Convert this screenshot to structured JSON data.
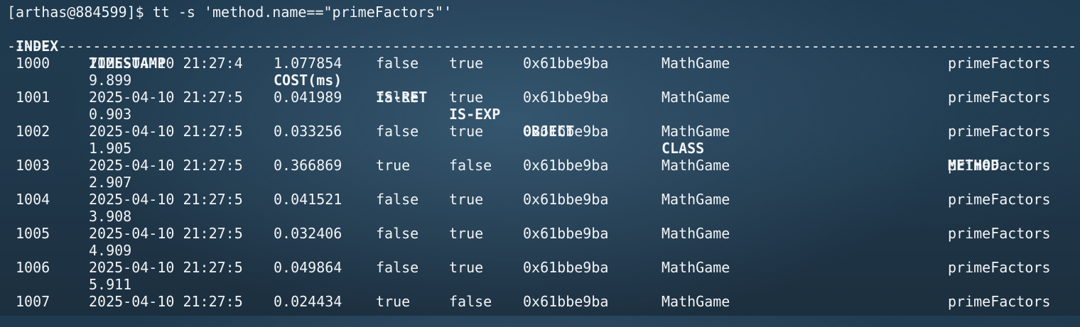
{
  "terminal": {
    "prompt": "[arthas@884599]$ tt -s 'method.name==\"primeFactors\"'",
    "headers": {
      "index": "INDEX",
      "timestamp": "TIMESTAMP",
      "cost": "COST(ms)",
      "is_ret": "IS-RET",
      "is_exp": "IS-EXP",
      "object": "OBJECT",
      "class": "CLASS",
      "method": "METHOD"
    },
    "separator": "--------------------------------------------------------------------------------------------------------------------------------------------------------------------------------------",
    "rows": [
      {
        "index": "1000",
        "ts1": "2025-04-10 21:27:4",
        "ts2": "9.899",
        "cost": "1.077854",
        "is_ret": "false",
        "is_exp": "true",
        "object": "0x61bbe9ba",
        "class": "MathGame",
        "method": "primeFactors"
      },
      {
        "index": "1001",
        "ts1": "2025-04-10 21:27:5",
        "ts2": "0.903",
        "cost": "0.041989",
        "is_ret": "false",
        "is_exp": "true",
        "object": "0x61bbe9ba",
        "class": "MathGame",
        "method": "primeFactors"
      },
      {
        "index": "1002",
        "ts1": "2025-04-10 21:27:5",
        "ts2": "1.905",
        "cost": "0.033256",
        "is_ret": "false",
        "is_exp": "true",
        "object": "0x61bbe9ba",
        "class": "MathGame",
        "method": "primeFactors"
      },
      {
        "index": "1003",
        "ts1": "2025-04-10 21:27:5",
        "ts2": "2.907",
        "cost": "0.366869",
        "is_ret": "true",
        "is_exp": "false",
        "object": "0x61bbe9ba",
        "class": "MathGame",
        "method": "primeFactors"
      },
      {
        "index": "1004",
        "ts1": "2025-04-10 21:27:5",
        "ts2": "3.908",
        "cost": "0.041521",
        "is_ret": "false",
        "is_exp": "true",
        "object": "0x61bbe9ba",
        "class": "MathGame",
        "method": "primeFactors"
      },
      {
        "index": "1005",
        "ts1": "2025-04-10 21:27:5",
        "ts2": "4.909",
        "cost": "0.032406",
        "is_ret": "false",
        "is_exp": "true",
        "object": "0x61bbe9ba",
        "class": "MathGame",
        "method": "primeFactors"
      },
      {
        "index": "1006",
        "ts1": "2025-04-10 21:27:5",
        "ts2": "5.911",
        "cost": "0.049864",
        "is_ret": "false",
        "is_exp": "true",
        "object": "0x61bbe9ba",
        "class": "MathGame",
        "method": "primeFactors"
      },
      {
        "index": "1007",
        "ts1": "2025-04-10 21:27:5",
        "ts2": "",
        "cost": "0.024434",
        "is_ret": "true",
        "is_exp": "false",
        "object": "0x61bbe9ba",
        "class": "MathGame",
        "method": "primeFactors"
      }
    ]
  }
}
